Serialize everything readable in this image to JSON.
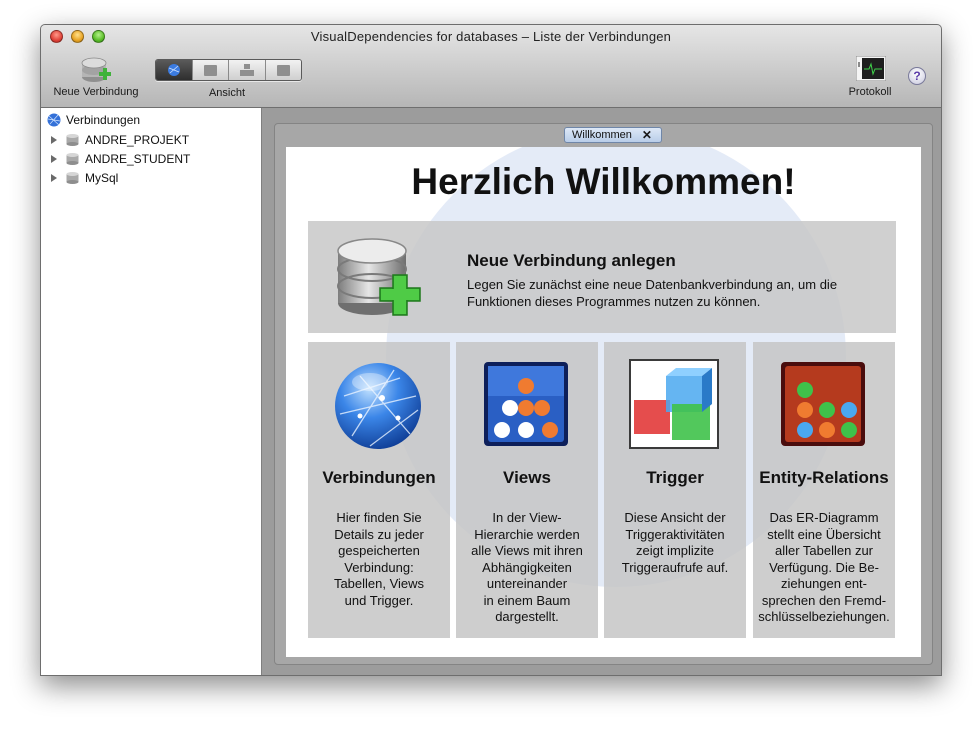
{
  "window": {
    "title": "VisualDependencies for databases – Liste der Verbindungen"
  },
  "toolbar": {
    "new_connection_label": "Neue Verbindung",
    "view_label": "Ansicht",
    "view_segments": [
      "globe-icon",
      "grid-icon",
      "stack-icon",
      "table-icon"
    ],
    "log_label": "Protokoll",
    "help_glyph": "?"
  },
  "sidebar": {
    "root_label": "Verbindungen",
    "items": [
      {
        "label": "ANDRE_PROJEKT"
      },
      {
        "label": "ANDRE_STUDENT"
      },
      {
        "label": "MySql"
      }
    ]
  },
  "tab": {
    "label": "Willkommen",
    "close_glyph": "✕"
  },
  "welcome": {
    "headline": "Herzlich Willkommen!",
    "new_connection": {
      "title": "Neue Verbindung anlegen",
      "description": "Legen Sie zunächst eine neue Datenbankverbindung an, um die Funktionen dieses Programmes nutzen zu können."
    },
    "cards": [
      {
        "title": "Verbindungen",
        "icon": "globe-icon",
        "description": "Hier finden Sie\nDetails zu jeder\ngespeicherten\nVerbindung:\nTabellen, Views\nund Trigger."
      },
      {
        "title": "Views",
        "icon": "views-icon",
        "description": "In der View-\nHierarchie werden\nalle Views mit ihren\nAbhängigkeiten\nuntereinander\nin einem Baum\ndargestellt."
      },
      {
        "title": "Trigger",
        "icon": "trigger-cubes-icon",
        "description": "Diese Ansicht der\nTriggeraktivitäten\nzeigt implizite\nTriggeraufrufe auf."
      },
      {
        "title": "Entity-Relations",
        "icon": "entity-relations-icon",
        "description": "Das ER-Diagramm\nstellt eine Übersicht\naller Tabellen zur\nVerfügung. Die Be-\nziehungen ent-\nsprechen den Fremd-\nschlüsselbeziehungen."
      }
    ]
  },
  "colors": {
    "accent_blue": "#2a5fc4",
    "plus_green": "#3fb23a"
  }
}
